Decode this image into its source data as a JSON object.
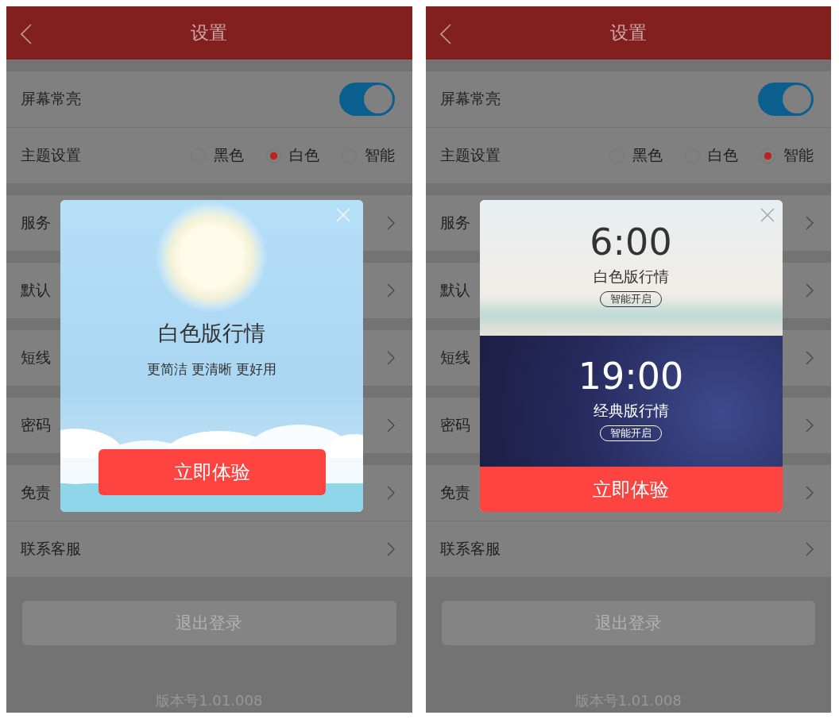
{
  "screens": [
    {
      "header": {
        "title": "设置"
      },
      "groups": [
        {
          "items": [
            {
              "kind": "toggle",
              "label": "屏幕常亮",
              "on": true
            },
            {
              "kind": "radio",
              "label": "主题设置",
              "options": [
                {
                  "label": "黑色",
                  "selected": false
                },
                {
                  "label": "白色",
                  "selected": true
                },
                {
                  "label": "智能",
                  "selected": false
                }
              ]
            }
          ]
        },
        {
          "items": [
            {
              "kind": "link",
              "label": "服务"
            }
          ]
        },
        {
          "items": [
            {
              "kind": "link",
              "label": "默认"
            }
          ]
        },
        {
          "items": [
            {
              "kind": "link",
              "label": "短线"
            }
          ]
        },
        {
          "items": [
            {
              "kind": "link",
              "label": "密码"
            }
          ]
        },
        {
          "items": [
            {
              "kind": "link",
              "label": "免责"
            },
            {
              "kind": "link",
              "label": "联系客服"
            }
          ]
        }
      ],
      "logout": "退出登录",
      "version": "版本号1.01.008",
      "dialog": {
        "kind": "sunny",
        "title": "白色版行情",
        "subtitle": "更简洁 更清晰 更好用",
        "button": "立即体验"
      }
    },
    {
      "header": {
        "title": "设置"
      },
      "groups": [
        {
          "items": [
            {
              "kind": "toggle",
              "label": "屏幕常亮",
              "on": true
            },
            {
              "kind": "radio",
              "label": "主题设置",
              "options": [
                {
                  "label": "黑色",
                  "selected": false
                },
                {
                  "label": "白色",
                  "selected": false
                },
                {
                  "label": "智能",
                  "selected": true
                }
              ]
            }
          ]
        },
        {
          "items": [
            {
              "kind": "link",
              "label": "服务"
            }
          ]
        },
        {
          "items": [
            {
              "kind": "link",
              "label": "默认"
            }
          ]
        },
        {
          "items": [
            {
              "kind": "link",
              "label": "短线"
            }
          ]
        },
        {
          "items": [
            {
              "kind": "link",
              "label": "密码"
            }
          ]
        },
        {
          "items": [
            {
              "kind": "link",
              "label": "免责"
            },
            {
              "kind": "link",
              "label": "联系客服"
            }
          ]
        }
      ],
      "logout": "退出登录",
      "version": "版本号1.01.008",
      "dialog": {
        "kind": "schedule",
        "panels": [
          {
            "kind": "day",
            "time": "6:00",
            "title": "白色版行情",
            "badge": "智能开启"
          },
          {
            "kind": "night",
            "time": "19:00",
            "title": "经典版行情",
            "badge": "智能开启"
          }
        ],
        "button": "立即体验"
      }
    }
  ]
}
